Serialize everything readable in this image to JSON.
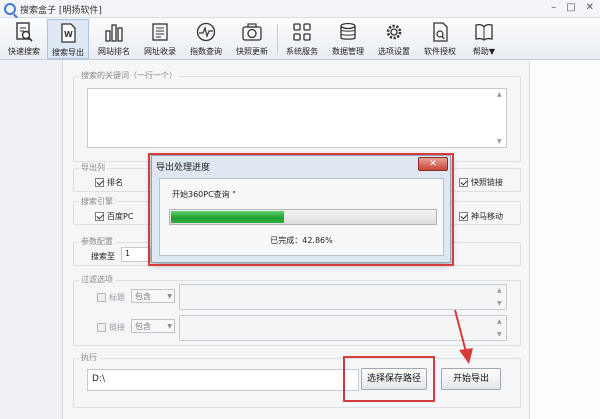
{
  "window": {
    "title": "搜索盒子 [明扬软件]",
    "controls": [
      "–",
      "□",
      "✕"
    ]
  },
  "toolbar": {
    "items": [
      {
        "label": "快速搜索",
        "icon": "search-doc-icon"
      },
      {
        "label": "搜索导出",
        "icon": "word-export-icon"
      },
      {
        "label": "网站排名",
        "icon": "bar-chart-icon"
      },
      {
        "label": "网址收录",
        "icon": "doc-list-icon"
      },
      {
        "label": "指数查询",
        "icon": "pulse-icon"
      },
      {
        "label": "快照更新",
        "icon": "camera-icon"
      },
      {
        "label": "系统服务",
        "icon": "grid-icon"
      },
      {
        "label": "数据管理",
        "icon": "database-icon"
      },
      {
        "label": "选项设置",
        "icon": "gear-icon"
      },
      {
        "label": "软件授权",
        "icon": "license-icon"
      },
      {
        "label": "帮助▼",
        "icon": "book-icon"
      }
    ]
  },
  "keywords": {
    "label": "搜索的关键词（一行一个）"
  },
  "export_cols": {
    "label": "导出列",
    "rank_label": "排名",
    "snapshot_label": "快照链接"
  },
  "engines": {
    "label": "搜索引擎",
    "baidu_label": "百度PC",
    "shenma_label": "神马移动"
  },
  "params": {
    "label": "参数配置",
    "search_to_label": "搜索至",
    "search_to_value": "1"
  },
  "filter": {
    "label": "过滤选项",
    "title_label": "标题",
    "link_label": "链接",
    "mode_option": "包含"
  },
  "execute": {
    "label": "执行",
    "path_value": "D:\\",
    "choose_path_label": "选择保存路径",
    "start_label": "开始导出"
  },
  "dialog": {
    "title": "导出处理进度",
    "close_glyph": "✕",
    "message": "开始360PC查询 \"",
    "progress_percent": 42.86,
    "done_text": "已完成：42.86%"
  },
  "colors": {
    "accent": "#3a7bd5",
    "progress_green": "#2fae3f",
    "highlight_red": "#d63a3a"
  }
}
